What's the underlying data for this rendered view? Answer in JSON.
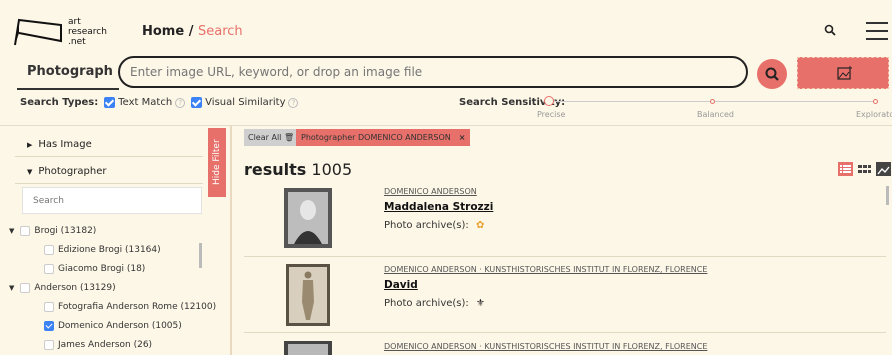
{
  "brand": {
    "logo_text": [
      "art",
      "research",
      ".net"
    ]
  },
  "breadcrumb": {
    "home": "Home",
    "separator": " / ",
    "current": "Search"
  },
  "search": {
    "type_label": "Photograph",
    "placeholder": "Enter image URL, keyword, or drop an image file"
  },
  "search_types": {
    "label": "Search Types:",
    "text_match": "Text Match",
    "visual_similarity": "Visual Similarity",
    "text_match_checked": true,
    "visual_similarity_checked": true
  },
  "sensitivity": {
    "label": "Search Sensitivity:",
    "options": [
      "Precise",
      "Balanced",
      "Exploratory"
    ],
    "selected": "Precise"
  },
  "sidebar": {
    "facets": [
      {
        "label": "Has Image",
        "expanded": false
      },
      {
        "label": "Photographer",
        "expanded": true
      }
    ],
    "filter_placeholder": "Search",
    "tree": [
      {
        "label": "Brogi (13182)",
        "level": 0,
        "checked": false,
        "expanded": true
      },
      {
        "label": "Edizione Brogi (13164)",
        "level": 1,
        "checked": false
      },
      {
        "label": "Giacomo Brogi (18)",
        "level": 1,
        "checked": false
      },
      {
        "label": "Anderson (13129)",
        "level": 0,
        "checked": false,
        "expanded": true
      },
      {
        "label": "Fotografia Anderson Rome (12100)",
        "level": 1,
        "checked": false
      },
      {
        "label": "Domenico Anderson (1005)",
        "level": 1,
        "checked": true
      },
      {
        "label": "James Anderson (26)",
        "level": 1,
        "checked": false
      }
    ],
    "hide_filter": "Hide Filter"
  },
  "results": {
    "clear_all": "Clear All",
    "active_filter": "Photographer DOMENICO ANDERSON",
    "label": "results",
    "count": "1005",
    "archive_label": "Photo archive(s):",
    "items": [
      {
        "meta": "DOMENICO ANDERSON",
        "title": "Maddalena Strozzi"
      },
      {
        "meta": "DOMENICO ANDERSON · KUNSTHISTORISCHES INSTITUT IN FLORENZ, FLORENCE",
        "title": "David"
      },
      {
        "meta": "DOMENICO ANDERSON · KUNSTHISTORISCHES INSTITUT IN FLORENZ, FLORENCE",
        "title": ""
      }
    ]
  },
  "colors": {
    "accent": "#e8706a",
    "background": "#fdf7e7",
    "checkbox": "#3b82f6"
  },
  "icons": [
    "logo-mark",
    "search-icon",
    "menu-icon",
    "caret-down-icon",
    "image-upload-icon",
    "help-icon",
    "trash-icon",
    "list-view-icon",
    "grid-view-icon",
    "image-view-icon",
    "archive-logo-icon"
  ]
}
